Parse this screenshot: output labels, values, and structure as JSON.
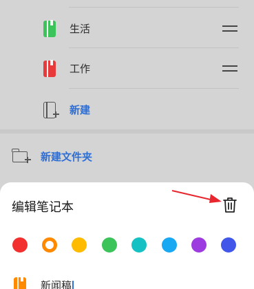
{
  "notebooks": [
    {
      "label": "生活",
      "color": "#3cc35a"
    },
    {
      "label": "工作",
      "color": "#e83a3a"
    }
  ],
  "new_notebook_label": "新建",
  "new_folder_label": "新建文件夹",
  "sheet": {
    "title": "编辑笔记本",
    "delete_icon": "trash-icon",
    "colors": [
      "#f23030",
      "#ff8a00",
      "#ffbb00",
      "#3cc35a",
      "#16c1c4",
      "#18a9f2",
      "#9b3be0",
      "#4257ea"
    ],
    "selected_color": "#ff8a00",
    "name_value": "新闻稿"
  }
}
